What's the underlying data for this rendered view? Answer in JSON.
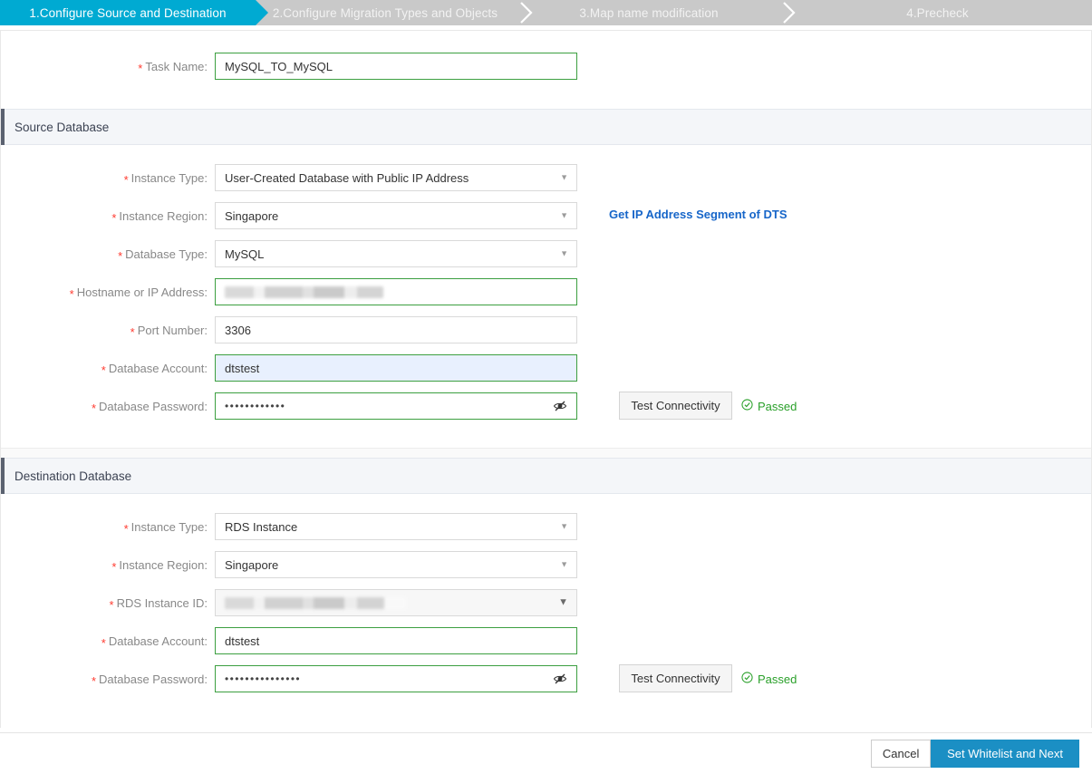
{
  "steps": [
    {
      "label": "1.Configure Source and Destination",
      "active": true
    },
    {
      "label": "2.Configure Migration Types and Objects",
      "active": false
    },
    {
      "label": "3.Map name modification",
      "active": false
    },
    {
      "label": "4.Precheck",
      "active": false
    }
  ],
  "task": {
    "label": "Task Name:",
    "value": "MySQL_TO_MySQL"
  },
  "source": {
    "section_title": "Source Database",
    "instance_type": {
      "label": "Instance Type:",
      "value": "User-Created Database with Public IP Address"
    },
    "instance_region": {
      "label": "Instance Region:",
      "value": "Singapore"
    },
    "database_type": {
      "label": "Database Type:",
      "value": "MySQL"
    },
    "hostname": {
      "label": "Hostname or IP Address:",
      "value": ""
    },
    "port": {
      "label": "Port Number:",
      "value": "3306"
    },
    "account": {
      "label": "Database Account:",
      "value": "dtstest"
    },
    "password": {
      "label": "Database Password:",
      "value": "••••••••••••"
    },
    "link_text": "Get IP Address Segment of DTS",
    "test_button": "Test Connectivity",
    "status": "Passed"
  },
  "destination": {
    "section_title": "Destination Database",
    "instance_type": {
      "label": "Instance Type:",
      "value": "RDS Instance"
    },
    "instance_region": {
      "label": "Instance Region:",
      "value": "Singapore"
    },
    "rds_instance_id": {
      "label": "RDS Instance ID:",
      "value": ""
    },
    "account": {
      "label": "Database Account:",
      "value": "dtstest"
    },
    "password": {
      "label": "Database Password:",
      "value": "•••••••••••••••"
    },
    "test_button": "Test Connectivity",
    "status": "Passed"
  },
  "footer": {
    "cancel": "Cancel",
    "next": "Set Whitelist and Next"
  },
  "colors": {
    "active_step": "#00aad2",
    "inactive_step": "#c9c9c9",
    "primary_button": "#1b8fc4",
    "link": "#1766c9",
    "success": "#2aa02a",
    "required": "#ff3b30",
    "valid_border": "#3c9f40"
  }
}
